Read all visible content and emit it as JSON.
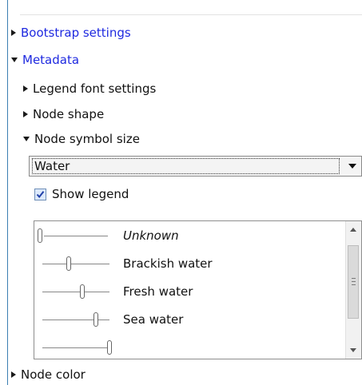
{
  "bootstrap_settings": "Bootstrap settings",
  "metadata": {
    "label": "Metadata",
    "legend_font_settings": "Legend font settings",
    "node_shape": "Node shape",
    "node_symbol_size": {
      "label": "Node symbol size",
      "dropdown_value": "Water",
      "show_legend": {
        "label": "Show legend",
        "checked": true
      },
      "legend_items": [
        {
          "label": "Unknown",
          "italic": true
        },
        {
          "label": "Brackish water"
        },
        {
          "label": "Fresh water"
        },
        {
          "label": "Sea water"
        }
      ]
    },
    "node_color": "Node color"
  },
  "colors": {
    "link": "#1f2ae0",
    "accent_line": "#3c7fb1"
  },
  "icons": {
    "expand": "triangle-right-icon",
    "collapse": "triangle-down-icon",
    "dropdown": "chevron-down-icon",
    "check": "checkmark-icon"
  }
}
